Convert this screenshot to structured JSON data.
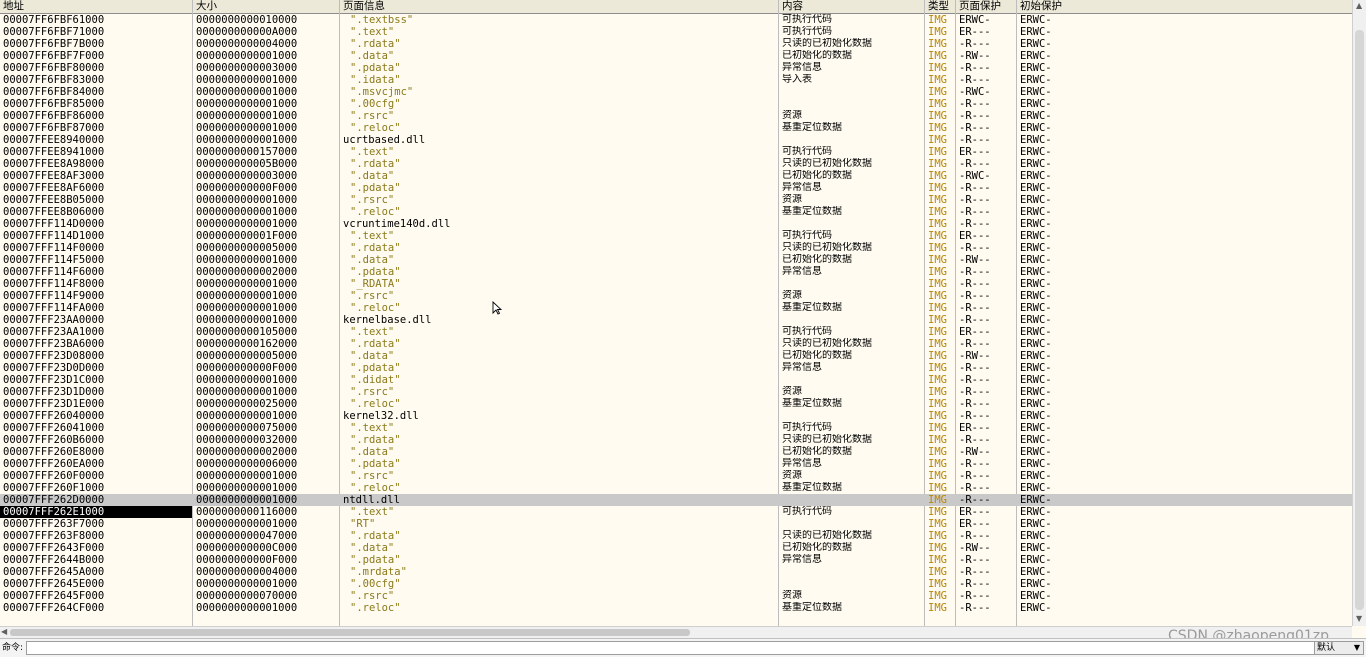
{
  "columns": {
    "address": "地址",
    "size": "大小",
    "info": "页面信息",
    "content": "内容",
    "type": "类型",
    "protection": "页面保护",
    "initial_protection": "初始保护"
  },
  "rows": [
    {
      "addr": "00007FF6FBF61000",
      "size": "0000000000010000",
      "info": "\".textbss\"",
      "kind": "sec",
      "content": "可执行代码",
      "type": "IMG",
      "prot": "ERWC-",
      "init": "ERWC-"
    },
    {
      "addr": "00007FF6FBF71000",
      "size": "000000000000A000",
      "info": "\".text\"",
      "kind": "sec",
      "content": "可执行代码",
      "type": "IMG",
      "prot": "ER---",
      "init": "ERWC-"
    },
    {
      "addr": "00007FF6FBF7B000",
      "size": "0000000000004000",
      "info": "\".rdata\"",
      "kind": "sec",
      "content": "只读的已初始化数据",
      "type": "IMG",
      "prot": "-R---",
      "init": "ERWC-"
    },
    {
      "addr": "00007FF6FBF7F000",
      "size": "0000000000001000",
      "info": "\".data\"",
      "kind": "sec",
      "content": "已初始化的数据",
      "type": "IMG",
      "prot": "-RW--",
      "init": "ERWC-"
    },
    {
      "addr": "00007FF6FBF80000",
      "size": "0000000000003000",
      "info": "\".pdata\"",
      "kind": "sec",
      "content": "异常信息",
      "type": "IMG",
      "prot": "-R---",
      "init": "ERWC-"
    },
    {
      "addr": "00007FF6FBF83000",
      "size": "0000000000001000",
      "info": "\".idata\"",
      "kind": "sec",
      "content": "导入表",
      "type": "IMG",
      "prot": "-R---",
      "init": "ERWC-"
    },
    {
      "addr": "00007FF6FBF84000",
      "size": "0000000000001000",
      "info": "\".msvcjmc\"",
      "kind": "sec",
      "content": "",
      "type": "IMG",
      "prot": "-RWC-",
      "init": "ERWC-"
    },
    {
      "addr": "00007FF6FBF85000",
      "size": "0000000000001000",
      "info": "\".00cfg\"",
      "kind": "sec",
      "content": "",
      "type": "IMG",
      "prot": "-R---",
      "init": "ERWC-"
    },
    {
      "addr": "00007FF6FBF86000",
      "size": "0000000000001000",
      "info": "\".rsrc\"",
      "kind": "sec",
      "content": "资源",
      "type": "IMG",
      "prot": "-R---",
      "init": "ERWC-"
    },
    {
      "addr": "00007FF6FBF87000",
      "size": "0000000000001000",
      "info": "\".reloc\"",
      "kind": "sec",
      "content": "基重定位数据",
      "type": "IMG",
      "prot": "-R---",
      "init": "ERWC-"
    },
    {
      "addr": "00007FFEE8940000",
      "size": "0000000000001000",
      "info": "ucrtbased.dll",
      "kind": "mod",
      "content": "",
      "type": "IMG",
      "prot": "-R---",
      "init": "ERWC-"
    },
    {
      "addr": "00007FFEE8941000",
      "size": "0000000000157000",
      "info": "\".text\"",
      "kind": "sec",
      "content": "可执行代码",
      "type": "IMG",
      "prot": "ER---",
      "init": "ERWC-"
    },
    {
      "addr": "00007FFEE8A98000",
      "size": "000000000005B000",
      "info": "\".rdata\"",
      "kind": "sec",
      "content": "只读的已初始化数据",
      "type": "IMG",
      "prot": "-R---",
      "init": "ERWC-"
    },
    {
      "addr": "00007FFEE8AF3000",
      "size": "0000000000003000",
      "info": "\".data\"",
      "kind": "sec",
      "content": "已初始化的数据",
      "type": "IMG",
      "prot": "-RWC-",
      "init": "ERWC-"
    },
    {
      "addr": "00007FFEE8AF6000",
      "size": "000000000000F000",
      "info": "\".pdata\"",
      "kind": "sec",
      "content": "异常信息",
      "type": "IMG",
      "prot": "-R---",
      "init": "ERWC-"
    },
    {
      "addr": "00007FFEE8B05000",
      "size": "0000000000001000",
      "info": "\".rsrc\"",
      "kind": "sec",
      "content": "资源",
      "type": "IMG",
      "prot": "-R---",
      "init": "ERWC-"
    },
    {
      "addr": "00007FFEE8B06000",
      "size": "0000000000001000",
      "info": "\".reloc\"",
      "kind": "sec",
      "content": "基重定位数据",
      "type": "IMG",
      "prot": "-R---",
      "init": "ERWC-"
    },
    {
      "addr": "00007FFF114D0000",
      "size": "0000000000001000",
      "info": "vcruntime140d.dll",
      "kind": "mod",
      "content": "",
      "type": "IMG",
      "prot": "-R---",
      "init": "ERWC-"
    },
    {
      "addr": "00007FFF114D1000",
      "size": "000000000001F000",
      "info": "\".text\"",
      "kind": "sec",
      "content": "可执行代码",
      "type": "IMG",
      "prot": "ER---",
      "init": "ERWC-"
    },
    {
      "addr": "00007FFF114F0000",
      "size": "0000000000005000",
      "info": "\".rdata\"",
      "kind": "sec",
      "content": "只读的已初始化数据",
      "type": "IMG",
      "prot": "-R---",
      "init": "ERWC-"
    },
    {
      "addr": "00007FFF114F5000",
      "size": "0000000000001000",
      "info": "\".data\"",
      "kind": "sec",
      "content": "已初始化的数据",
      "type": "IMG",
      "prot": "-RW--",
      "init": "ERWC-"
    },
    {
      "addr": "00007FFF114F6000",
      "size": "0000000000002000",
      "info": "\".pdata\"",
      "kind": "sec",
      "content": "异常信息",
      "type": "IMG",
      "prot": "-R---",
      "init": "ERWC-"
    },
    {
      "addr": "00007FFF114F8000",
      "size": "0000000000001000",
      "info": "\"_RDATA\"",
      "kind": "sec",
      "content": "",
      "type": "IMG",
      "prot": "-R---",
      "init": "ERWC-"
    },
    {
      "addr": "00007FFF114F9000",
      "size": "0000000000001000",
      "info": "\".rsrc\"",
      "kind": "sec",
      "content": "资源",
      "type": "IMG",
      "prot": "-R---",
      "init": "ERWC-"
    },
    {
      "addr": "00007FFF114FA000",
      "size": "0000000000001000",
      "info": "\".reloc\"",
      "kind": "sec",
      "content": "基重定位数据",
      "type": "IMG",
      "prot": "-R---",
      "init": "ERWC-"
    },
    {
      "addr": "00007FFF23AA0000",
      "size": "0000000000001000",
      "info": "kernelbase.dll",
      "kind": "mod",
      "content": "",
      "type": "IMG",
      "prot": "-R---",
      "init": "ERWC-"
    },
    {
      "addr": "00007FFF23AA1000",
      "size": "0000000000105000",
      "info": "\".text\"",
      "kind": "sec",
      "content": "可执行代码",
      "type": "IMG",
      "prot": "ER---",
      "init": "ERWC-"
    },
    {
      "addr": "00007FFF23BA6000",
      "size": "0000000000162000",
      "info": "\".rdata\"",
      "kind": "sec",
      "content": "只读的已初始化数据",
      "type": "IMG",
      "prot": "-R---",
      "init": "ERWC-"
    },
    {
      "addr": "00007FFF23D08000",
      "size": "0000000000005000",
      "info": "\".data\"",
      "kind": "sec",
      "content": "已初始化的数据",
      "type": "IMG",
      "prot": "-RW--",
      "init": "ERWC-"
    },
    {
      "addr": "00007FFF23D0D000",
      "size": "000000000000F000",
      "info": "\".pdata\"",
      "kind": "sec",
      "content": "异常信息",
      "type": "IMG",
      "prot": "-R---",
      "init": "ERWC-"
    },
    {
      "addr": "00007FFF23D1C000",
      "size": "0000000000001000",
      "info": "\".didat\"",
      "kind": "sec",
      "content": "",
      "type": "IMG",
      "prot": "-R---",
      "init": "ERWC-"
    },
    {
      "addr": "00007FFF23D1D000",
      "size": "0000000000001000",
      "info": "\".rsrc\"",
      "kind": "sec",
      "content": "资源",
      "type": "IMG",
      "prot": "-R---",
      "init": "ERWC-"
    },
    {
      "addr": "00007FFF23D1E000",
      "size": "0000000000025000",
      "info": "\".reloc\"",
      "kind": "sec",
      "content": "基重定位数据",
      "type": "IMG",
      "prot": "-R---",
      "init": "ERWC-"
    },
    {
      "addr": "00007FFF26040000",
      "size": "0000000000001000",
      "info": "kernel32.dll",
      "kind": "mod",
      "content": "",
      "type": "IMG",
      "prot": "-R---",
      "init": "ERWC-"
    },
    {
      "addr": "00007FFF26041000",
      "size": "0000000000075000",
      "info": "\".text\"",
      "kind": "sec",
      "content": "可执行代码",
      "type": "IMG",
      "prot": "ER---",
      "init": "ERWC-"
    },
    {
      "addr": "00007FFF260B6000",
      "size": "0000000000032000",
      "info": "\".rdata\"",
      "kind": "sec",
      "content": "只读的已初始化数据",
      "type": "IMG",
      "prot": "-R---",
      "init": "ERWC-"
    },
    {
      "addr": "00007FFF260E8000",
      "size": "0000000000002000",
      "info": "\".data\"",
      "kind": "sec",
      "content": "已初始化的数据",
      "type": "IMG",
      "prot": "-RW--",
      "init": "ERWC-"
    },
    {
      "addr": "00007FFF260EA000",
      "size": "0000000000006000",
      "info": "\".pdata\"",
      "kind": "sec",
      "content": "异常信息",
      "type": "IMG",
      "prot": "-R---",
      "init": "ERWC-"
    },
    {
      "addr": "00007FFF260F0000",
      "size": "0000000000001000",
      "info": "\".rsrc\"",
      "kind": "sec",
      "content": "资源",
      "type": "IMG",
      "prot": "-R---",
      "init": "ERWC-"
    },
    {
      "addr": "00007FFF260F1000",
      "size": "0000000000001000",
      "info": "\".reloc\"",
      "kind": "sec",
      "content": "基重定位数据",
      "type": "IMG",
      "prot": "-R---",
      "init": "ERWC-"
    },
    {
      "addr": "00007FFF262D0000",
      "size": "0000000000001000",
      "info": "ntdll.dll",
      "kind": "mod",
      "content": "",
      "type": "IMG",
      "prot": "-R---",
      "init": "ERWC-",
      "selected": true
    },
    {
      "addr": "00007FFF262E1000",
      "size": "0000000000116000",
      "info": "\".text\"",
      "kind": "sec",
      "content": "可执行代码",
      "type": "IMG",
      "prot": "ER---",
      "init": "ERWC-",
      "active": true
    },
    {
      "addr": "00007FFF263F7000",
      "size": "0000000000001000",
      "info": "\"RT\"",
      "kind": "sec",
      "content": "",
      "type": "IMG",
      "prot": "ER---",
      "init": "ERWC-"
    },
    {
      "addr": "00007FFF263F8000",
      "size": "0000000000047000",
      "info": "\".rdata\"",
      "kind": "sec",
      "content": "只读的已初始化数据",
      "type": "IMG",
      "prot": "-R---",
      "init": "ERWC-"
    },
    {
      "addr": "00007FFF2643F000",
      "size": "000000000000C000",
      "info": "\".data\"",
      "kind": "sec",
      "content": "已初始化的数据",
      "type": "IMG",
      "prot": "-RW--",
      "init": "ERWC-"
    },
    {
      "addr": "00007FFF2644B000",
      "size": "000000000000F000",
      "info": "\".pdata\"",
      "kind": "sec",
      "content": "异常信息",
      "type": "IMG",
      "prot": "-R---",
      "init": "ERWC-"
    },
    {
      "addr": "00007FFF2645A000",
      "size": "0000000000004000",
      "info": "\".mrdata\"",
      "kind": "sec",
      "content": "",
      "type": "IMG",
      "prot": "-R---",
      "init": "ERWC-"
    },
    {
      "addr": "00007FFF2645E000",
      "size": "0000000000001000",
      "info": "\".00cfg\"",
      "kind": "sec",
      "content": "",
      "type": "IMG",
      "prot": "-R---",
      "init": "ERWC-"
    },
    {
      "addr": "00007FFF2645F000",
      "size": "0000000000070000",
      "info": "\".rsrc\"",
      "kind": "sec",
      "content": "资源",
      "type": "IMG",
      "prot": "-R---",
      "init": "ERWC-"
    },
    {
      "addr": "00007FFF264CF000",
      "size": "0000000000001000",
      "info": "\".reloc\"",
      "kind": "sec",
      "content": "基重定位数据",
      "type": "IMG",
      "prot": "-R---",
      "init": "ERWC-"
    }
  ],
  "command_bar": {
    "label": "命令:",
    "value": "",
    "select_value": "默认"
  },
  "watermark": "CSDN @zhaopeng01zp",
  "colors": {
    "background": "#fffbf0",
    "section_text": "#8a7a1a",
    "type_text": "#b8860b",
    "selected_row": "#c9c9c9"
  }
}
